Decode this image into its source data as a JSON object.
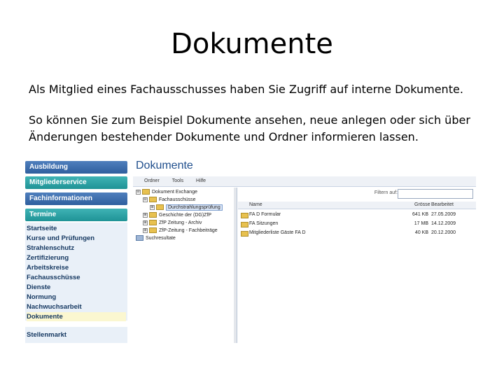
{
  "slide": {
    "title": "Dokumente",
    "paragraph1": "Als Mitglied eines Fachausschusses haben Sie Zugriff auf interne Dokumente.",
    "paragraph2": "So können Sie zum Beispiel Dokumente ansehen, neue anlegen oder sich über Änderungen bestehender Dokumente und Ordner informieren lassen."
  },
  "sidebar": {
    "nav": [
      {
        "label": "Ausbildung",
        "color": "#3a6aa8"
      },
      {
        "label": "Mitgliederservice",
        "color": "#2aa3a6"
      },
      {
        "label": "Fachinformationen",
        "color": "#3a6aa8"
      },
      {
        "label": "Termine",
        "color": "#2aa3a6"
      }
    ],
    "items": [
      {
        "label": "Startseite"
      },
      {
        "label": "Kurse und Prüfungen"
      },
      {
        "label": "Strahlenschutz"
      },
      {
        "label": "Zertifizierung"
      },
      {
        "label": "Arbeitskreise"
      },
      {
        "label": "Fachausschüsse"
      },
      {
        "label": "Dienste"
      },
      {
        "label": "Normung"
      },
      {
        "label": "Nachwuchsarbeit"
      },
      {
        "label": "Dokumente",
        "active": true
      }
    ],
    "bottom_label": "Stellenmarkt"
  },
  "main": {
    "title": "Dokumente",
    "menu": [
      "Ordner",
      "Tools",
      "Hilfe"
    ],
    "tree": [
      {
        "label": "Dokument Exchange",
        "level": 0,
        "toggle": "⊟"
      },
      {
        "label": "Fachausschüsse",
        "level": 1,
        "toggle": "⊟"
      },
      {
        "label": "Durchstrahlungsprüfung",
        "level": 2,
        "toggle": "⊞",
        "selected": true
      },
      {
        "label": "Geschichte der (DG)ZfP",
        "level": 1,
        "toggle": "⊞"
      },
      {
        "label": "ZfP Zeitung - Archiv",
        "level": 1,
        "toggle": "⊞"
      },
      {
        "label": "ZfP-Zeitung - Fachbeiträge",
        "level": 1,
        "toggle": "⊞"
      },
      {
        "label": "Suchresultate",
        "level": 0,
        "toggle": ""
      }
    ],
    "filter_label": "Filtern auf:",
    "filter_value": "",
    "columns": {
      "name": "Name",
      "size": "Grösse",
      "date": "Bearbeitet"
    },
    "rows": [
      {
        "name": "FA D Formular",
        "size": "641 KB",
        "date": "27.05.2009"
      },
      {
        "name": "FA Sitzungen",
        "size": "17 MB",
        "date": "14.12.2009"
      },
      {
        "name": "Mitgliederliste Gäste FA D",
        "size": "40 KB",
        "date": "20.12.2000"
      }
    ]
  }
}
